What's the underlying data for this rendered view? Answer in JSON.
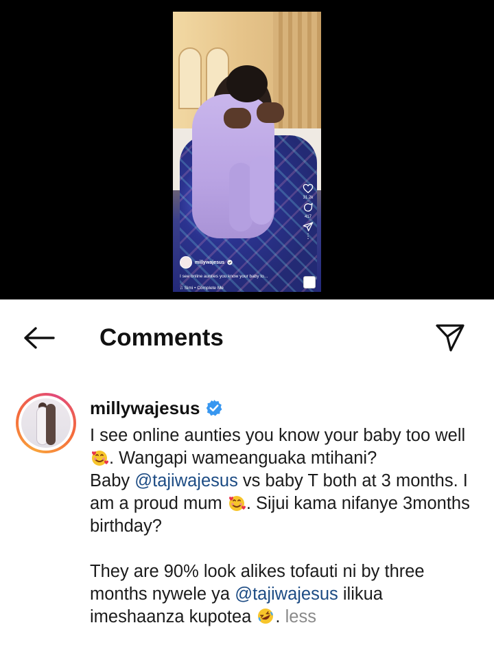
{
  "reel": {
    "username": "millywajesus",
    "caption": "I see online aunties you know your baby to...",
    "music": "Simi • Complete Me",
    "like_count": "31.2k",
    "comment_count": "417"
  },
  "header": {
    "title": "Comments"
  },
  "comment": {
    "username": "millywajesus",
    "p1_a": "I see online aunties you know your baby too well ",
    "p1_b": ". Wangapi wameanguaka mtihani?",
    "p2_a": "Baby ",
    "mention1": "@tajiwajesus",
    "p2_b": " vs baby T both at 3 months. I am a proud mum ",
    "p2_c": ". Sijui kama nifanye 3months birthday?",
    "p3_a": "They are 90% look alikes tofauti ni by three months nywele ya ",
    "mention2": "@tajiwajesus",
    "p3_b": " ilikua imeshaanza kupotea ",
    "less": "less"
  },
  "colors": {
    "mention": "#1d4c84",
    "verified": "#3897f0",
    "less": "#8a8a8a"
  },
  "icons": [
    "back-arrow-icon",
    "send-icon",
    "verified-badge-icon",
    "heart-icon",
    "comment-icon",
    "share-icon",
    "smiling-face-with-hearts-icon",
    "rolling-laughing-icon"
  ]
}
